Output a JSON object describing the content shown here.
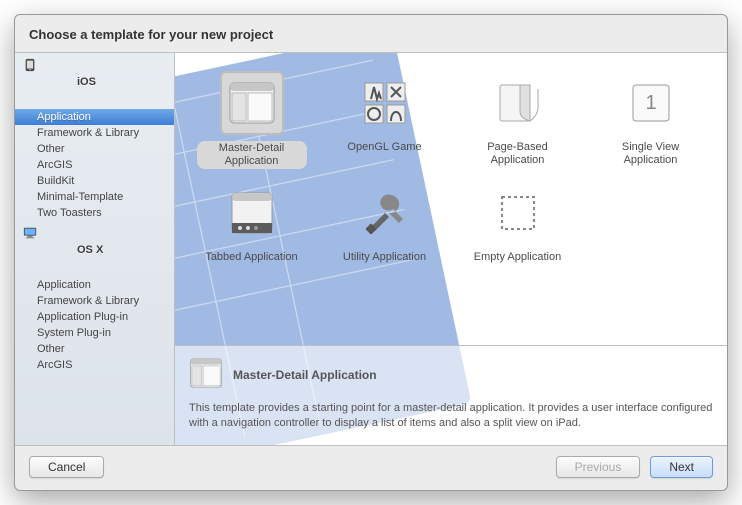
{
  "header": {
    "title": "Choose a template for your new project"
  },
  "sidebar": {
    "groups": [
      {
        "icon": "ios",
        "label": "iOS",
        "items": [
          {
            "label": "Application",
            "selected": true
          },
          {
            "label": "Framework & Library"
          },
          {
            "label": "Other"
          },
          {
            "label": "ArcGIS"
          },
          {
            "label": "BuildKit"
          },
          {
            "label": "Minimal-Template"
          },
          {
            "label": "Two Toasters"
          }
        ]
      },
      {
        "icon": "osx",
        "label": "OS X",
        "items": [
          {
            "label": "Application"
          },
          {
            "label": "Framework & Library"
          },
          {
            "label": "Application Plug-in"
          },
          {
            "label": "System Plug-in"
          },
          {
            "label": "Other"
          },
          {
            "label": "ArcGIS"
          }
        ]
      }
    ]
  },
  "templates": [
    {
      "label": "Master-Detail Application",
      "icon": "masterdetail",
      "selected": true
    },
    {
      "label": "OpenGL Game",
      "icon": "opengl"
    },
    {
      "label": "Page-Based Application",
      "icon": "pagebased"
    },
    {
      "label": "Single View Application",
      "icon": "singleview"
    },
    {
      "label": "Tabbed Application",
      "icon": "tabbed"
    },
    {
      "label": "Utility Application",
      "icon": "utility"
    },
    {
      "label": "Empty Application",
      "icon": "empty"
    }
  ],
  "description": {
    "title": "Master-Detail Application",
    "text": "This template provides a starting point for a master-detail application. It provides a user interface configured with a navigation controller to display a list of items and also a split view on iPad."
  },
  "buttons": {
    "cancel": "Cancel",
    "previous": "Previous",
    "next": "Next"
  }
}
